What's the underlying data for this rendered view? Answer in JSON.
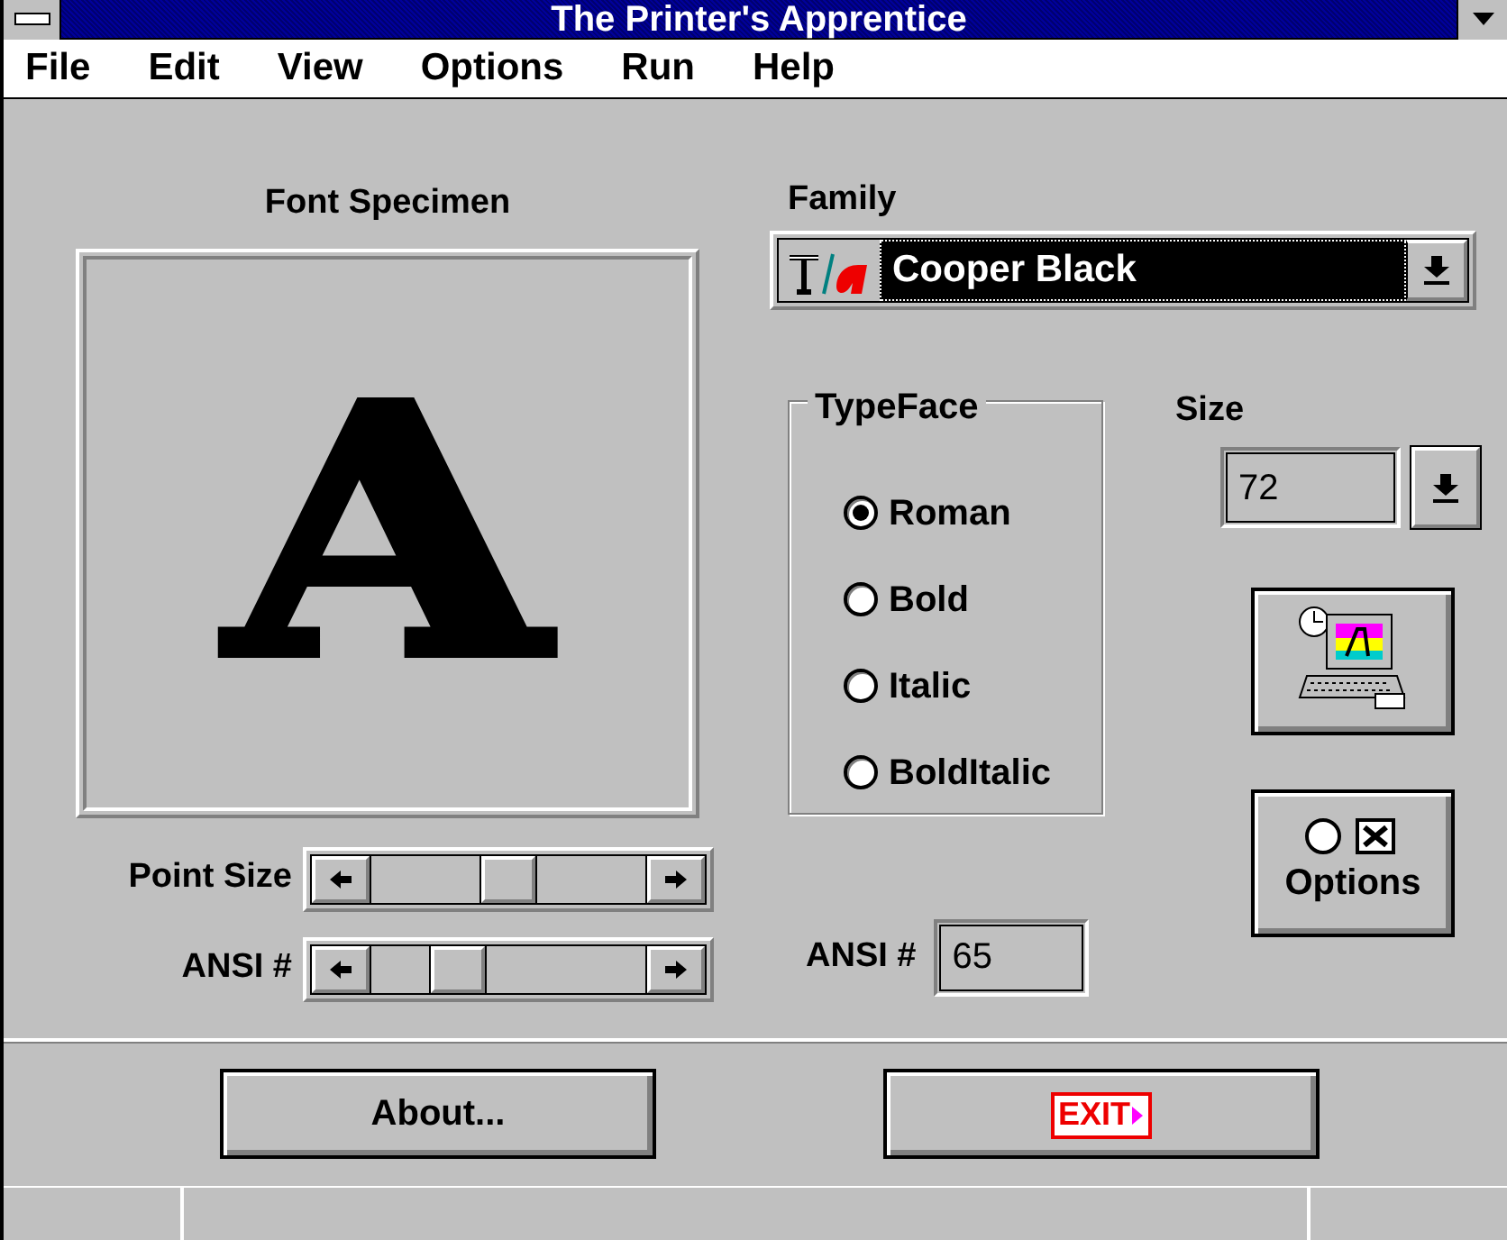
{
  "window": {
    "title": "The Printer's Apprentice"
  },
  "menu": [
    {
      "label": "File"
    },
    {
      "label": "Edit"
    },
    {
      "label": "View"
    },
    {
      "label": "Options"
    },
    {
      "label": "Run"
    },
    {
      "label": "Help"
    }
  ],
  "specimen": {
    "label": "Font Specimen",
    "glyph": "A"
  },
  "sliders": [
    {
      "label": "Point Size"
    },
    {
      "label": "ANSI #"
    }
  ],
  "family": {
    "label": "Family",
    "value": "Cooper Black"
  },
  "typeface": {
    "label": "TypeFace",
    "options": [
      {
        "label": "Roman",
        "selected": true
      },
      {
        "label": "Bold",
        "selected": false
      },
      {
        "label": "Italic",
        "selected": false
      },
      {
        "label": "BoldItalic",
        "selected": false
      }
    ]
  },
  "size": {
    "label": "Size",
    "value": "72"
  },
  "options_button": {
    "label": "Options"
  },
  "ansi": {
    "label": "ANSI #",
    "value": "65"
  },
  "buttons": [
    {
      "kind": "text",
      "label": "About..."
    },
    {
      "kind": "exit",
      "label": "EXIT"
    }
  ]
}
